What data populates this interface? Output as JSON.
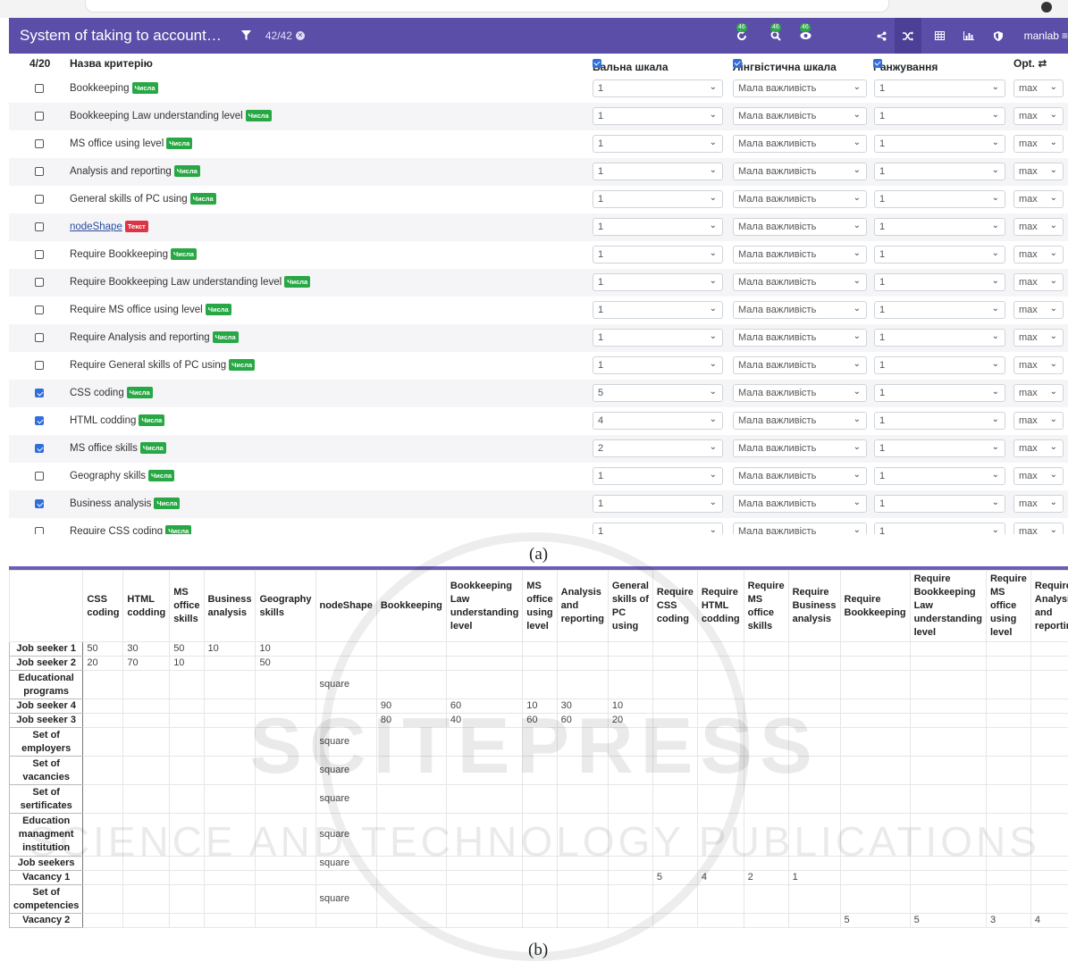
{
  "figure_a": {
    "caption": "(a)",
    "app_title": "System of taking to account…",
    "filter_count": "42/42",
    "toolbar_badge": "46",
    "user": "manlab",
    "header": {
      "selected": "4/20",
      "name_col": "Назва критерію",
      "score_col": "Бальна шкала",
      "ling_col": "Лінгвістична шкала",
      "rank_col": "Ранжування",
      "opt_col": "Opt. ⇄"
    },
    "tag_num": "Числа",
    "tag_text": "Текст",
    "rows": [
      {
        "name": "Bookkeeping",
        "checked": false,
        "type": "num",
        "score": "1",
        "ling": "Мала важливість",
        "rank": "1",
        "opt": "max"
      },
      {
        "name": "Bookkeeping Law understanding level",
        "checked": false,
        "type": "num",
        "score": "1",
        "ling": "Мала важливість",
        "rank": "1",
        "opt": "max"
      },
      {
        "name": "MS office using level",
        "checked": false,
        "type": "num",
        "score": "1",
        "ling": "Мала важливість",
        "rank": "1",
        "opt": "max"
      },
      {
        "name": "Analysis and reporting",
        "checked": false,
        "type": "num",
        "score": "1",
        "ling": "Мала важливість",
        "rank": "1",
        "opt": "max"
      },
      {
        "name": "General skills of PC using",
        "checked": false,
        "type": "num",
        "score": "1",
        "ling": "Мала важливість",
        "rank": "1",
        "opt": "max"
      },
      {
        "name": "nodeShape",
        "checked": false,
        "type": "txt",
        "score": "1",
        "ling": "Мала важливість",
        "rank": "1",
        "opt": "max"
      },
      {
        "name": "Require Bookkeeping",
        "checked": false,
        "type": "num",
        "score": "1",
        "ling": "Мала важливість",
        "rank": "1",
        "opt": "max"
      },
      {
        "name": "Require Bookkeeping Law understanding level",
        "checked": false,
        "type": "num",
        "score": "1",
        "ling": "Мала важливість",
        "rank": "1",
        "opt": "max"
      },
      {
        "name": "Require MS office using level",
        "checked": false,
        "type": "num",
        "score": "1",
        "ling": "Мала важливість",
        "rank": "1",
        "opt": "max"
      },
      {
        "name": "Require Analysis and reporting",
        "checked": false,
        "type": "num",
        "score": "1",
        "ling": "Мала важливість",
        "rank": "1",
        "opt": "max"
      },
      {
        "name": "Require General skills of PC using",
        "checked": false,
        "type": "num",
        "score": "1",
        "ling": "Мала важливість",
        "rank": "1",
        "opt": "max"
      },
      {
        "name": "CSS coding",
        "checked": true,
        "type": "num",
        "score": "5",
        "ling": "Мала важливість",
        "rank": "1",
        "opt": "max"
      },
      {
        "name": "HTML codding",
        "checked": true,
        "type": "num",
        "score": "4",
        "ling": "Мала важливість",
        "rank": "1",
        "opt": "max"
      },
      {
        "name": "MS office skills",
        "checked": true,
        "type": "num",
        "score": "2",
        "ling": "Мала важливість",
        "rank": "1",
        "opt": "max"
      },
      {
        "name": "Geography skills",
        "checked": false,
        "type": "num",
        "score": "1",
        "ling": "Мала важливість",
        "rank": "1",
        "opt": "max"
      },
      {
        "name": "Business analysis",
        "checked": true,
        "type": "num",
        "score": "1",
        "ling": "Мала важливість",
        "rank": "1",
        "opt": "max"
      },
      {
        "name": "Require CSS coding",
        "checked": false,
        "type": "num",
        "score": "1",
        "ling": "Мала важливість",
        "rank": "1",
        "opt": "max"
      }
    ]
  },
  "figure_b": {
    "caption": "(b)",
    "columns": [
      "CSS coding",
      "HTML codding",
      "MS office skills",
      "Business analysis",
      "Geography skills",
      "nodeShape",
      "Bookkeeping",
      "Bookkeeping Law understanding level",
      "MS office using level",
      "Analysis and reporting",
      "General skills of PC using",
      "Require CSS coding",
      "Require HTML codding",
      "Require MS office skills",
      "Require Business analysis",
      "Require Bookkeeping",
      "Require Bookkeeping Law understanding level",
      "Require MS office using level",
      "Require Analysis and reporting"
    ],
    "rows": [
      {
        "label": "Job seeker 1",
        "cells": [
          "50",
          "30",
          "50",
          "10",
          "10",
          "",
          "",
          "",
          "",
          "",
          "",
          "",
          "",
          "",
          "",
          "",
          "",
          "",
          ""
        ]
      },
      {
        "label": "Job seeker 2",
        "cells": [
          "20",
          "70",
          "10",
          "",
          "50",
          "",
          "",
          "",
          "",
          "",
          "",
          "",
          "",
          "",
          "",
          "",
          "",
          "",
          ""
        ]
      },
      {
        "label": "Educational programs",
        "cells": [
          "",
          "",
          "",
          "",
          "",
          "square",
          "",
          "",
          "",
          "",
          "",
          "",
          "",
          "",
          "",
          "",
          "",
          "",
          ""
        ]
      },
      {
        "label": "Job seeker 4",
        "cells": [
          "",
          "",
          "",
          "",
          "",
          "",
          "90",
          "60",
          "10",
          "30",
          "10",
          "",
          "",
          "",
          "",
          "",
          "",
          "",
          ""
        ]
      },
      {
        "label": "Job seeker 3",
        "cells": [
          "",
          "",
          "",
          "",
          "",
          "",
          "80",
          "40",
          "60",
          "60",
          "20",
          "",
          "",
          "",
          "",
          "",
          "",
          "",
          ""
        ]
      },
      {
        "label": "Set of employers",
        "cells": [
          "",
          "",
          "",
          "",
          "",
          "square",
          "",
          "",
          "",
          "",
          "",
          "",
          "",
          "",
          "",
          "",
          "",
          "",
          ""
        ]
      },
      {
        "label": "Set of vacancies",
        "cells": [
          "",
          "",
          "",
          "",
          "",
          "square",
          "",
          "",
          "",
          "",
          "",
          "",
          "",
          "",
          "",
          "",
          "",
          "",
          ""
        ]
      },
      {
        "label": "Set of sertificates",
        "cells": [
          "",
          "",
          "",
          "",
          "",
          "square",
          "",
          "",
          "",
          "",
          "",
          "",
          "",
          "",
          "",
          "",
          "",
          "",
          ""
        ]
      },
      {
        "label": "Education managment institution",
        "cells": [
          "",
          "",
          "",
          "",
          "",
          "square",
          "",
          "",
          "",
          "",
          "",
          "",
          "",
          "",
          "",
          "",
          "",
          "",
          ""
        ]
      },
      {
        "label": "Job seekers",
        "cells": [
          "",
          "",
          "",
          "",
          "",
          "square",
          "",
          "",
          "",
          "",
          "",
          "",
          "",
          "",
          "",
          "",
          "",
          "",
          ""
        ]
      },
      {
        "label": "Vacancy 1",
        "cells": [
          "",
          "",
          "",
          "",
          "",
          "",
          "",
          "",
          "",
          "",
          "",
          "5",
          "4",
          "2",
          "1",
          "",
          "",
          "",
          ""
        ]
      },
      {
        "label": "Set of competencies",
        "cells": [
          "",
          "",
          "",
          "",
          "",
          "square",
          "",
          "",
          "",
          "",
          "",
          "",
          "",
          "",
          "",
          "",
          "",
          "",
          ""
        ]
      },
      {
        "label": "Vacancy 2",
        "cells": [
          "",
          "",
          "",
          "",
          "",
          "",
          "",
          "",
          "",
          "",
          "",
          "",
          "",
          "",
          "",
          "5",
          "5",
          "3",
          "4"
        ]
      }
    ]
  },
  "watermark": [
    "SCITEPRESS",
    "SCIENCE AND TECHNOLOGY PUBLICATIONS"
  ],
  "colors": {
    "appbar": "#5b4ea8",
    "tag_num": "#28a745",
    "tag_text": "#dc3545",
    "check": "#2f6fdb"
  }
}
